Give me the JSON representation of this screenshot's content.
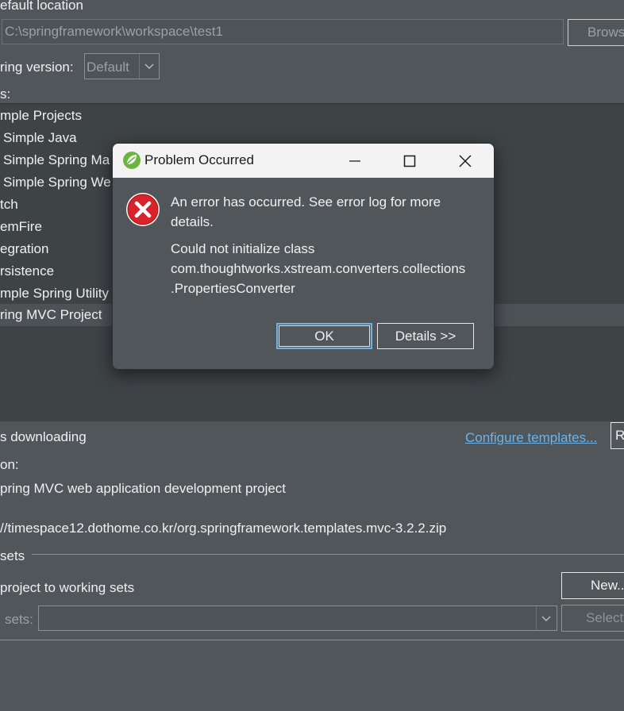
{
  "bg": {
    "location_label": "efault location",
    "location_value": "C:\\springframework\\workspace\\test1",
    "browse_label": "Brows",
    "spring_version_label": "ring version:",
    "spring_version_value": "Default",
    "templates_label": "s:",
    "list_items": [
      "mple Projects",
      "Simple Java",
      "Simple Spring Ma",
      "Simple Spring We",
      "tch",
      "emFire",
      "egration",
      "rsistence",
      "mple Spring Utility",
      "ring MVC Project"
    ],
    "downloading_label": "s downloading",
    "configure_templates_link": "Configure templates...",
    "refresh_label": "R",
    "description_label": "on:",
    "description_text": "pring MVC web application development project",
    "url_text": "//timespace12.dothome.co.kr/org.springframework.templates.mvc-3.2.2.zip",
    "working_sets_group": "sets",
    "add_to_working_sets": "project to working sets",
    "new_button": "New...",
    "sets_label": "sets:",
    "select_button": "Select"
  },
  "dialog": {
    "title": "Problem Occurred",
    "message_line1": "An error has occurred. See error log for more",
    "message_line2": "details.",
    "detail_line1": "Could not initialize class",
    "detail_line2": "com.thoughtworks.xstream.converters.collections",
    "detail_line3": ".PropertiesConverter",
    "ok_label": "OK",
    "details_label": "Details >>"
  },
  "colors": {
    "background": "#50565a",
    "list_background": "#3e4346",
    "link": "#6eb3e8",
    "error_red": "#d9232a",
    "spring_green": "#6db33f"
  },
  "icons": {
    "dialog_app_icon": "spring-leaf-icon",
    "error_icon": "error-x-icon",
    "minimize": "minimize-icon",
    "maximize": "maximize-icon",
    "close": "close-icon",
    "dropdown": "chevron-down-icon"
  }
}
